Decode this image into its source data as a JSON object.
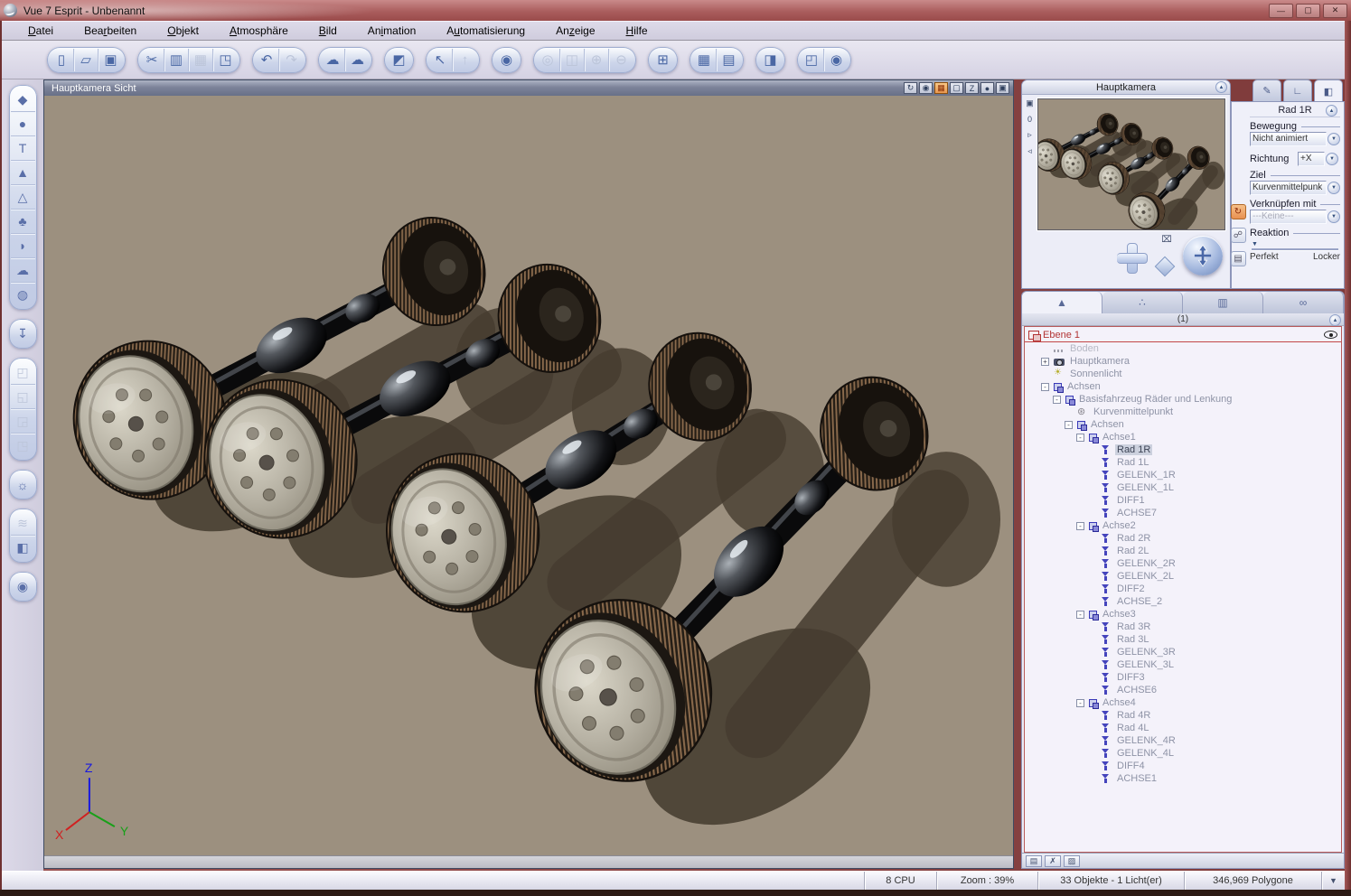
{
  "window": {
    "title": "Vue 7 Esprit - Unbenannt",
    "controls": [
      {
        "name": "minimize-button",
        "glyph": "—"
      },
      {
        "name": "maximize-button",
        "glyph": "▢"
      },
      {
        "name": "close-button",
        "glyph": "✕"
      }
    ]
  },
  "menu": {
    "items": [
      {
        "name": "menu-datei",
        "label": "Datei",
        "u": 0
      },
      {
        "name": "menu-bearbeiten",
        "label": "Bearbeiten",
        "u": 3
      },
      {
        "name": "menu-objekt",
        "label": "Objekt",
        "u": 0
      },
      {
        "name": "menu-atmosphaere",
        "label": "Atmosphäre",
        "u": 0
      },
      {
        "name": "menu-bild",
        "label": "Bild",
        "u": 0
      },
      {
        "name": "menu-animation",
        "label": "Animation",
        "u": 2
      },
      {
        "name": "menu-automatisierung",
        "label": "Automatisierung",
        "u": 1
      },
      {
        "name": "menu-anzeige",
        "label": "Anzeige",
        "u": 2
      },
      {
        "name": "menu-hilfe",
        "label": "Hilfe",
        "u": 0
      }
    ]
  },
  "main_toolbar": {
    "groups": [
      {
        "buttons": [
          {
            "name": "new-scene-button",
            "glyph": "▯"
          },
          {
            "name": "open-scene-button",
            "glyph": "▱"
          },
          {
            "name": "save-scene-button",
            "glyph": "▣"
          }
        ]
      },
      {
        "buttons": [
          {
            "name": "cut-button",
            "glyph": "✂"
          },
          {
            "name": "copy-button",
            "glyph": "▥"
          },
          {
            "name": "paste-button",
            "glyph": "▦",
            "cls": "disabled"
          },
          {
            "name": "paste-as-object-button",
            "glyph": "◳"
          }
        ]
      },
      {
        "buttons": [
          {
            "name": "undo-button",
            "glyph": "↶"
          },
          {
            "name": "redo-button",
            "glyph": "↷",
            "cls": "disabled"
          }
        ]
      },
      {
        "buttons": [
          {
            "name": "edit-atmosphere-button",
            "glyph": "☁"
          },
          {
            "name": "load-atmosphere-button",
            "glyph": "☁"
          }
        ]
      },
      {
        "buttons": [
          {
            "name": "object-properties-button",
            "glyph": "◩"
          }
        ]
      },
      {
        "buttons": [
          {
            "name": "edit-object-tool-button",
            "glyph": "↖"
          },
          {
            "name": "edit-object-alt-button",
            "glyph": "↑",
            "cls": "disabled"
          }
        ]
      },
      {
        "buttons": [
          {
            "name": "quick-render-preview-button",
            "glyph": "◉"
          }
        ]
      },
      {
        "buttons": [
          {
            "name": "zoom-region-button",
            "glyph": "◎",
            "cls": "disabled"
          },
          {
            "name": "zoom-selection-button",
            "glyph": "◫",
            "cls": "disabled"
          },
          {
            "name": "zoom-in-button",
            "glyph": "⊕",
            "cls": "disabled"
          },
          {
            "name": "zoom-out-button",
            "glyph": "⊖",
            "cls": "disabled"
          }
        ]
      },
      {
        "buttons": [
          {
            "name": "quad-view-button",
            "glyph": "⊞"
          }
        ]
      },
      {
        "buttons": [
          {
            "name": "render-button",
            "glyph": "▦"
          },
          {
            "name": "render-to-disk-button",
            "glyph": "▤"
          }
        ]
      },
      {
        "buttons": [
          {
            "name": "animation-setup-button",
            "glyph": "◨"
          }
        ]
      },
      {
        "buttons": [
          {
            "name": "render-options-button",
            "glyph": "◰"
          },
          {
            "name": "render-camera-button",
            "glyph": "◉"
          }
        ]
      }
    ]
  },
  "left_toolbar": {
    "groups": [
      {
        "buttons": [
          {
            "name": "primitives-tool",
            "glyph": "◆"
          },
          {
            "name": "sphere-tool",
            "glyph": "●"
          },
          {
            "name": "text-tool",
            "glyph": "T"
          },
          {
            "name": "terrain-tool",
            "glyph": "▲"
          },
          {
            "name": "procedural-terrain-tool",
            "glyph": "△"
          },
          {
            "name": "plant-tool",
            "glyph": "♣"
          },
          {
            "name": "rock-tool",
            "glyph": "◗"
          },
          {
            "name": "cloud-tool",
            "glyph": "☁"
          },
          {
            "name": "planet-tool",
            "glyph": "◍"
          }
        ]
      },
      {
        "buttons": [
          {
            "name": "load-object-tool",
            "glyph": "↧"
          }
        ]
      },
      {
        "buttons": [
          {
            "name": "character-tool",
            "glyph": "◰",
            "cls": "disabled"
          },
          {
            "name": "poser-tool",
            "glyph": "◱",
            "cls": "disabled"
          },
          {
            "name": "balloon-tool",
            "glyph": "◲",
            "cls": "disabled"
          },
          {
            "name": "vehicle-tool",
            "glyph": "◳",
            "cls": "disabled"
          }
        ]
      },
      {
        "buttons": [
          {
            "name": "light-tool",
            "glyph": "☼"
          }
        ]
      },
      {
        "buttons": [
          {
            "name": "cloud-layer-tool",
            "glyph": "≋",
            "cls": "disabled"
          },
          {
            "name": "object-group-tool",
            "glyph": "◧"
          }
        ]
      },
      {
        "buttons": [
          {
            "name": "camera-tool",
            "glyph": "◉"
          }
        ]
      }
    ]
  },
  "viewport": {
    "title": "Hauptkamera Sicht",
    "icons": [
      {
        "name": "refresh-view-icon",
        "glyph": "↻"
      },
      {
        "name": "camera-settings-icon",
        "glyph": "◉"
      },
      {
        "name": "display-textured-icon",
        "glyph": "▦",
        "cls": "active"
      },
      {
        "name": "display-flat-icon",
        "glyph": "▢"
      },
      {
        "name": "display-wireframe-icon",
        "glyph": "Z"
      },
      {
        "name": "display-smooth-icon",
        "glyph": "●"
      },
      {
        "name": "save-view-icon",
        "glyph": "▣"
      }
    ],
    "axis": {
      "x": "X",
      "y": "Y",
      "z": "Z"
    }
  },
  "camera_panel": {
    "title": "Hauptkamera",
    "strip": [
      {
        "name": "save-camera-view-icon",
        "glyph": "▣"
      },
      {
        "name": "camera-counter",
        "glyph": "0"
      },
      {
        "name": "next-camera-icon",
        "glyph": "▹"
      },
      {
        "name": "prev-camera-icon",
        "glyph": "◃"
      }
    ],
    "mute_glyph": "⌧"
  },
  "properties": {
    "tabs": [
      {
        "name": "tab-paint",
        "glyph": "✎"
      },
      {
        "name": "tab-numerics",
        "glyph": "∟"
      },
      {
        "name": "tab-aspect",
        "glyph": "◧",
        "cls": "active"
      }
    ],
    "title": "Rad 1R",
    "bewegung_label": "Bewegung",
    "bewegung_value": "Nicht animiert",
    "richtung_label": "Richtung",
    "richtung_value": "+X",
    "ziel_label": "Ziel",
    "ziel_value": "Kurvenmittelpunk",
    "verknuepfen_label": "Verknüpfen mit",
    "verknuepfen_value": "---Keine---",
    "reaktion_label": "Reaktion",
    "reaktion_left": "Perfekt",
    "reaktion_right": "Locker",
    "slider_marker": "▼",
    "side_icons": [
      {
        "name": "motion-link-icon",
        "glyph": "↻",
        "cls": "active"
      },
      {
        "name": "attach-icon",
        "glyph": "☍"
      },
      {
        "name": "stack-icon",
        "glyph": "▤"
      }
    ]
  },
  "world_browser": {
    "tabs": [
      {
        "name": "tab-objects",
        "glyph": "▲",
        "cls": "active"
      },
      {
        "name": "tab-materials",
        "glyph": "∴"
      },
      {
        "name": "tab-collections",
        "glyph": "▥"
      },
      {
        "name": "tab-links",
        "glyph": "∞"
      }
    ],
    "header": "(1)",
    "layer_label": "Ebene 1",
    "items": [
      {
        "name": "tree-item-boden",
        "label": "Boden",
        "ind": 18,
        "exp": "",
        "icon": "ground",
        "cls": "dim"
      },
      {
        "name": "tree-item-hauptkamera",
        "label": "Hauptkamera",
        "ind": 18,
        "exp": "+",
        "icon": "camera"
      },
      {
        "name": "tree-item-sonnenlicht",
        "label": "Sonnenlicht",
        "ind": 18,
        "exp": "",
        "icon": "sun"
      },
      {
        "name": "tree-item-achsen",
        "label": "Achsen",
        "ind": 18,
        "exp": "-",
        "icon": "group"
      },
      {
        "name": "tree-item-basisfahrzeug",
        "label": "Basisfahrzeug Räder und Lenkung",
        "ind": 31,
        "exp": "-",
        "icon": "group"
      },
      {
        "name": "tree-item-kurvenmittelpunkt",
        "label": "Kurvenmittelpunkt",
        "ind": 44,
        "exp": "",
        "icon": "gear"
      },
      {
        "name": "tree-item-achsen-2",
        "label": "Achsen",
        "ind": 44,
        "exp": "-",
        "icon": "group"
      },
      {
        "name": "tree-item-achse1",
        "label": "Achse1",
        "ind": 57,
        "exp": "-",
        "icon": "group"
      },
      {
        "name": "tree-item-rad-1r",
        "label": "Rad 1R",
        "ind": 70,
        "exp": "",
        "icon": "object",
        "cls": "sel"
      },
      {
        "name": "tree-item-rad-1l",
        "label": "Rad 1L",
        "ind": 70,
        "exp": "",
        "icon": "object"
      },
      {
        "name": "tree-item-gelenk-1r",
        "label": "GELENK_1R",
        "ind": 70,
        "exp": "",
        "icon": "object"
      },
      {
        "name": "tree-item-gelenk-1l",
        "label": "GELENK_1L",
        "ind": 70,
        "exp": "",
        "icon": "object"
      },
      {
        "name": "tree-item-diff1",
        "label": "DIFF1",
        "ind": 70,
        "exp": "",
        "icon": "object"
      },
      {
        "name": "tree-item-achse7",
        "label": "ACHSE7",
        "ind": 70,
        "exp": "",
        "icon": "object"
      },
      {
        "name": "tree-item-achse2",
        "label": "Achse2",
        "ind": 57,
        "exp": "-",
        "icon": "group"
      },
      {
        "name": "tree-item-rad-2r",
        "label": "Rad 2R",
        "ind": 70,
        "exp": "",
        "icon": "object"
      },
      {
        "name": "tree-item-rad-2l",
        "label": "Rad 2L",
        "ind": 70,
        "exp": "",
        "icon": "object"
      },
      {
        "name": "tree-item-gelenk-2r",
        "label": "GELENK_2R",
        "ind": 70,
        "exp": "",
        "icon": "object"
      },
      {
        "name": "tree-item-gelenk-2l",
        "label": "GELENK_2L",
        "ind": 70,
        "exp": "",
        "icon": "object"
      },
      {
        "name": "tree-item-diff2",
        "label": "DIFF2",
        "ind": 70,
        "exp": "",
        "icon": "object"
      },
      {
        "name": "tree-item-achse-2",
        "label": "ACHSE_2",
        "ind": 70,
        "exp": "",
        "icon": "object"
      },
      {
        "name": "tree-item-achse3",
        "label": "Achse3",
        "ind": 57,
        "exp": "-",
        "icon": "group"
      },
      {
        "name": "tree-item-rad-3r",
        "label": "Rad 3R",
        "ind": 70,
        "exp": "",
        "icon": "object"
      },
      {
        "name": "tree-item-rad-3l",
        "label": "Rad 3L",
        "ind": 70,
        "exp": "",
        "icon": "object"
      },
      {
        "name": "tree-item-gelenk-3r",
        "label": "GELENK_3R",
        "ind": 70,
        "exp": "",
        "icon": "object"
      },
      {
        "name": "tree-item-gelenk-3l",
        "label": "GELENK_3L",
        "ind": 70,
        "exp": "",
        "icon": "object"
      },
      {
        "name": "tree-item-diff3",
        "label": "DIFF3",
        "ind": 70,
        "exp": "",
        "icon": "object"
      },
      {
        "name": "tree-item-achse6",
        "label": "ACHSE6",
        "ind": 70,
        "exp": "",
        "icon": "object"
      },
      {
        "name": "tree-item-achse4",
        "label": "Achse4",
        "ind": 57,
        "exp": "-",
        "icon": "group"
      },
      {
        "name": "tree-item-rad-4r",
        "label": "Rad 4R",
        "ind": 70,
        "exp": "",
        "icon": "object"
      },
      {
        "name": "tree-item-rad-4l",
        "label": "Rad 4L",
        "ind": 70,
        "exp": "",
        "icon": "object"
      },
      {
        "name": "tree-item-gelenk-4r",
        "label": "GELENK_4R",
        "ind": 70,
        "exp": "",
        "icon": "object"
      },
      {
        "name": "tree-item-gelenk-4l",
        "label": "GELENK_4L",
        "ind": 70,
        "exp": "",
        "icon": "object"
      },
      {
        "name": "tree-item-diff4",
        "label": "DIFF4",
        "ind": 70,
        "exp": "",
        "icon": "object"
      },
      {
        "name": "tree-item-achse1-obj",
        "label": "ACHSE1",
        "ind": 70,
        "exp": "",
        "icon": "object"
      }
    ],
    "footer": [
      {
        "name": "add-layer-button",
        "glyph": "▤"
      },
      {
        "name": "delete-button",
        "glyph": "✗"
      },
      {
        "name": "layer-options-button",
        "glyph": "▨"
      }
    ]
  },
  "statusbar": {
    "cpu": "8 CPU",
    "zoom": "Zoom : 39%",
    "objects": "33 Objekte - 1 Licht(er)",
    "polygons": "346,969 Polygone",
    "more_glyph": "▼"
  },
  "ui": {
    "collapse_glyph": "▲",
    "dd_glyph": "▼"
  },
  "accent_colors": {
    "frame_red": "#9a4b4b",
    "panel_blue": "#ecedf7",
    "viewport_ground": "#9c907f",
    "selection": "#ccd1de",
    "layer_red": "#b23434"
  }
}
